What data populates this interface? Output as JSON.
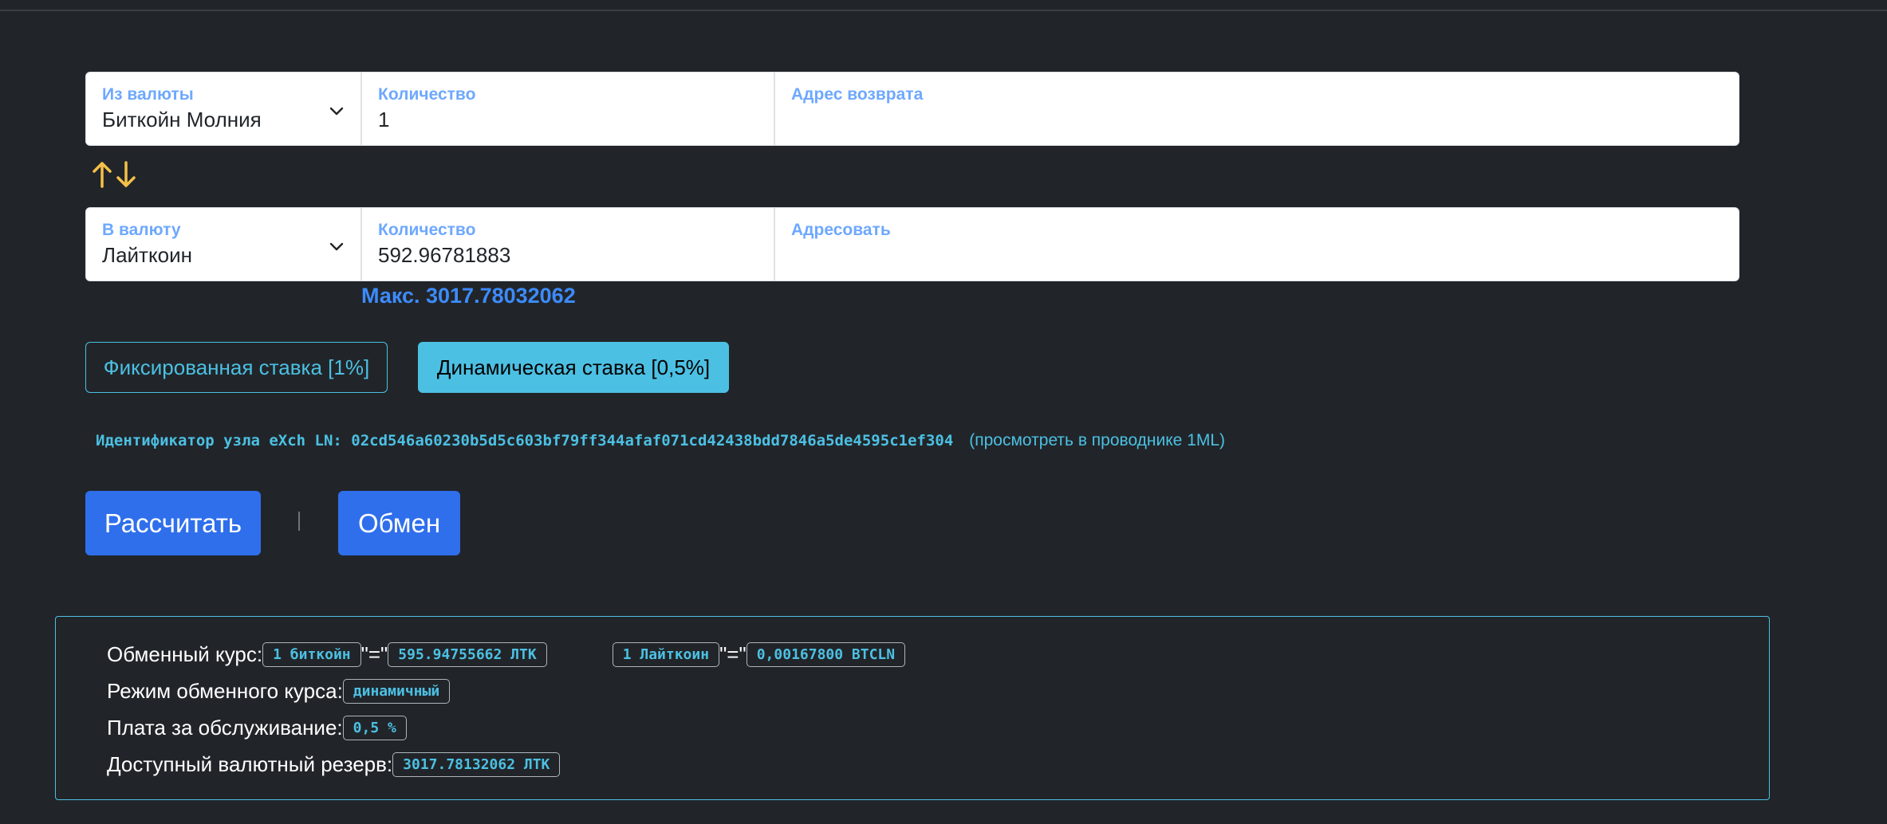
{
  "from": {
    "currency_label": "Из валюты",
    "currency_value": "Биткойн Молния",
    "amount_label": "Количество",
    "amount_value": "1",
    "address_label": "Адрес возврата",
    "address_value": ""
  },
  "to": {
    "currency_label": "В валюту",
    "currency_value": "Лайткоин",
    "amount_label": "Количество",
    "amount_value": "592.96781883",
    "address_label": "Адресовать",
    "address_value": "",
    "max_label": "Макс. 3017.78032062"
  },
  "rates": {
    "fixed_label": "Фиксированная ставка [1%]",
    "dynamic_label": "Динамическая ставка [0,5%]",
    "selected": "dynamic"
  },
  "node": {
    "id_text": "Идентификатор узла eXch LN: 02cd546a60230b5d5c603bf79ff344afaf071cd42438bdd7846a5de4595c1ef304",
    "explorer_link": "(просмотреть в проводнике 1ML)"
  },
  "actions": {
    "calculate_label": "Рассчитать",
    "exchange_label": "Обмен"
  },
  "info": {
    "rate_label": "Обменный курс:",
    "rate_from_tag": "1 биткойн",
    "eq_text": "\"=\"",
    "rate_from_value": "595.94755662 ЛТК",
    "rate_to_tag": "1 Лайткоин",
    "rate_to_value": "0,00167800 BTCLN",
    "mode_label": "Режим обменного курса:",
    "mode_value": "динамичный",
    "fee_label": "Плата за обслуживание:",
    "fee_value": "0,5 %",
    "reserve_label": "Доступный валютный резерв:",
    "reserve_value": "3017.78132062 ЛТК"
  },
  "colors": {
    "background": "#212529",
    "accent_cyan": "#4cc0e3",
    "accent_blue": "#2f6fec",
    "label_blue": "#6ea8fe",
    "swap_arrows": "#f5c04a"
  },
  "icons": {
    "from_dropdown": "chevron-down-icon",
    "to_dropdown": "chevron-down-icon",
    "swap": "swap-arrows-icon"
  }
}
